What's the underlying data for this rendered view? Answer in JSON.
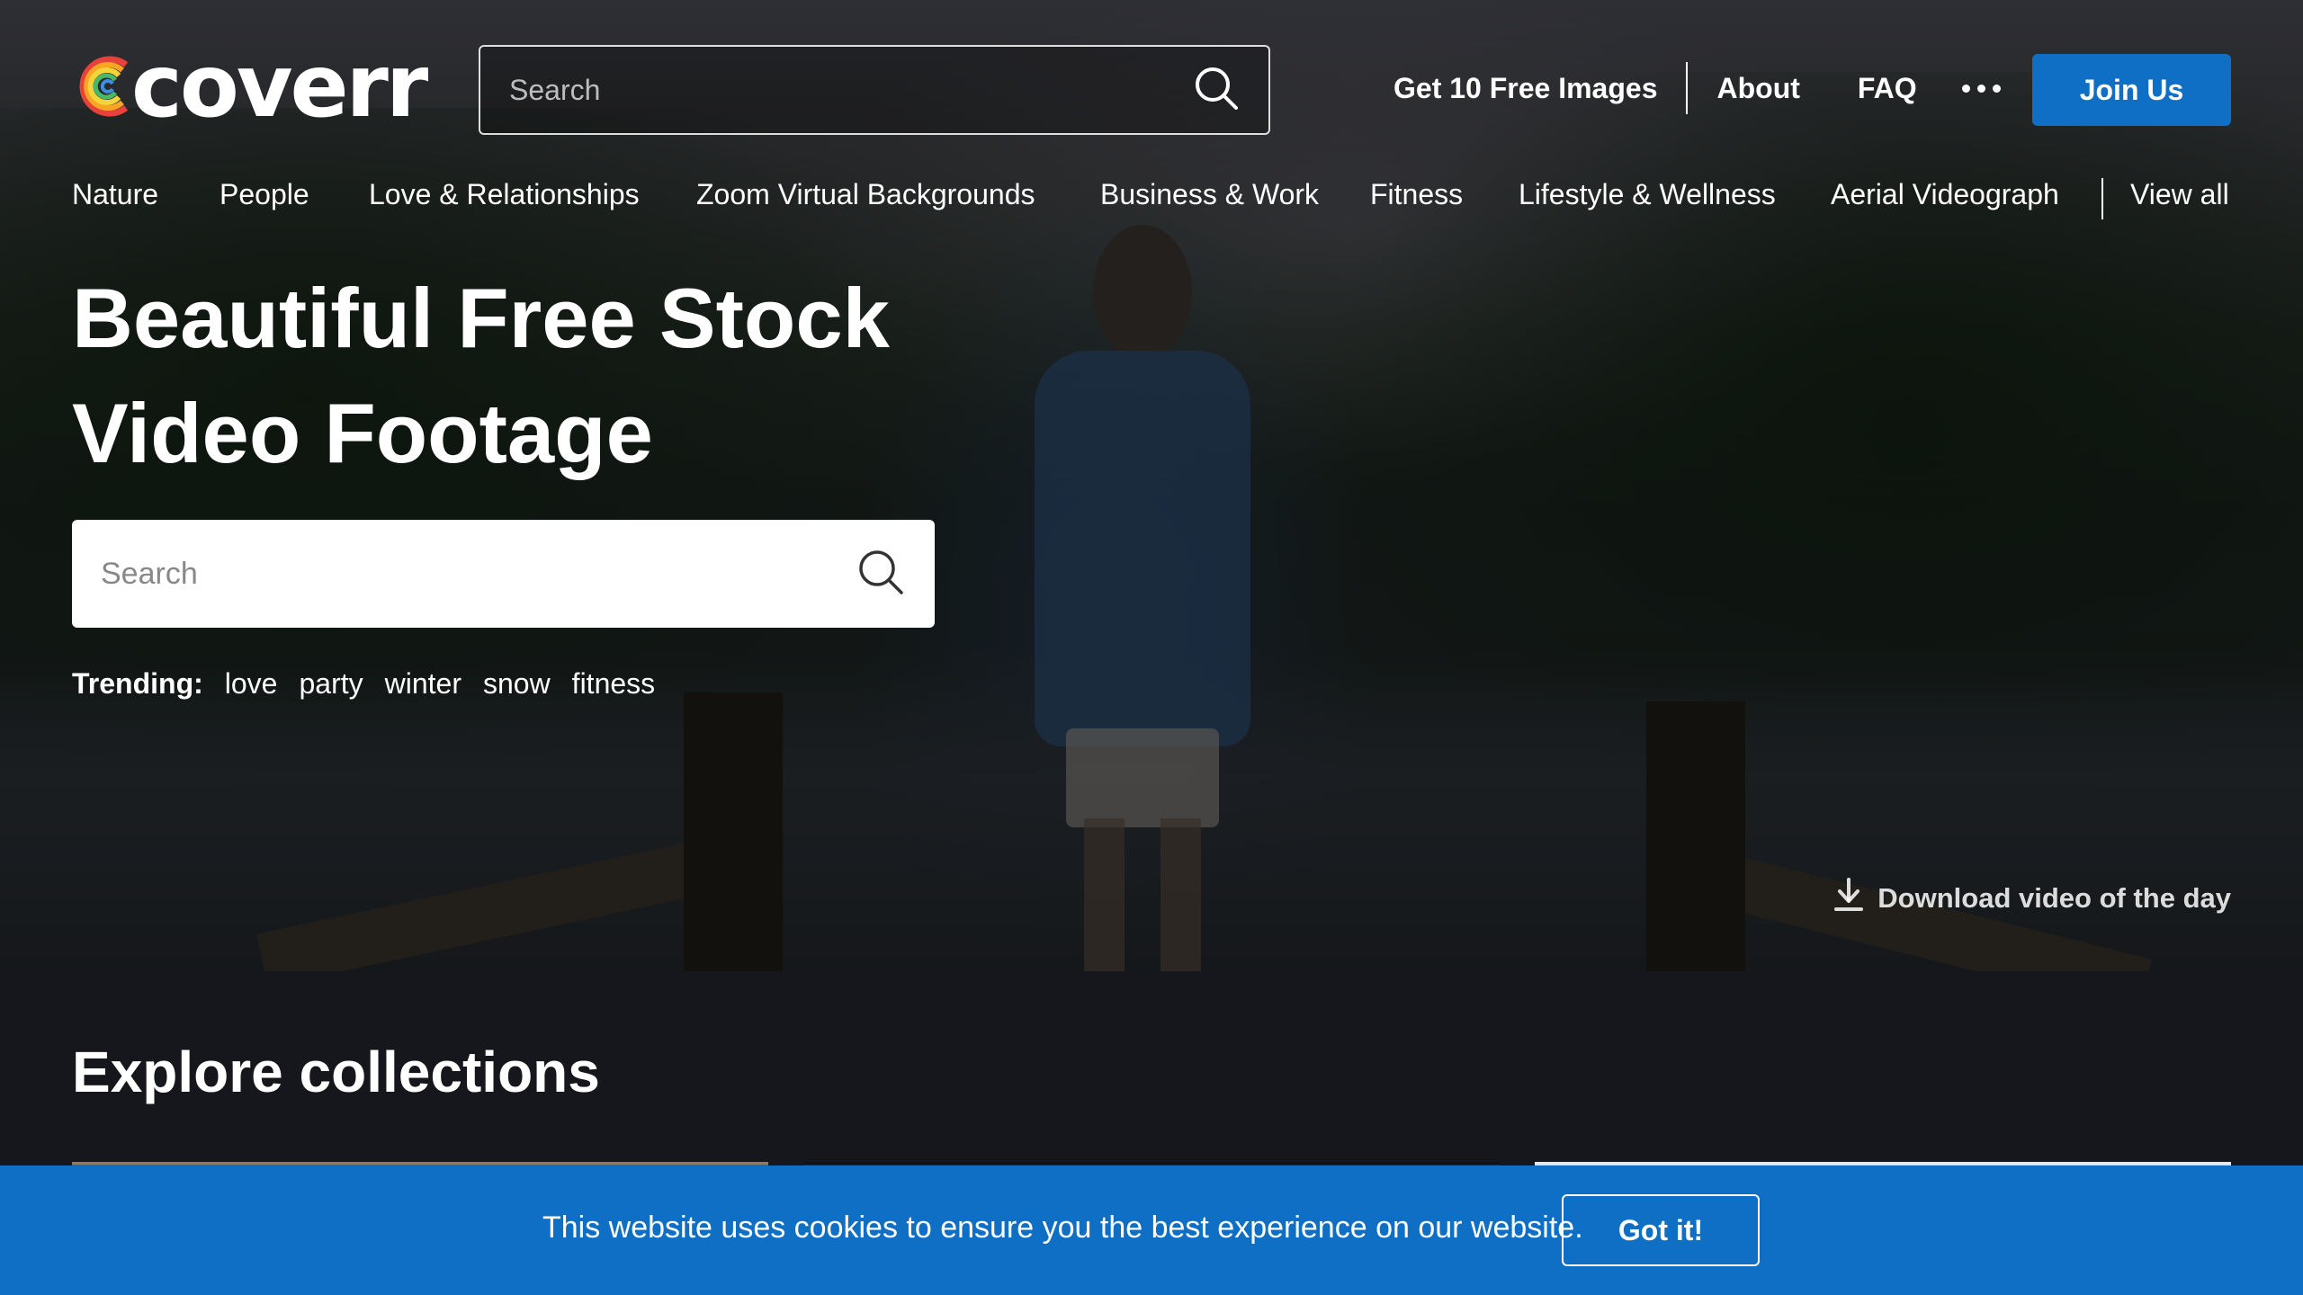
{
  "brand": {
    "name": "coverr"
  },
  "header": {
    "search_placeholder": "Search",
    "nav": {
      "free_images": "Get 10 Free Images",
      "about": "About",
      "faq": "FAQ"
    },
    "join_label": "Join Us"
  },
  "categories": [
    "Nature",
    "People",
    "Love & Relationships",
    "Zoom Virtual Backgrounds",
    "Business & Work",
    "Fitness",
    "Lifestyle & Wellness",
    "Aerial Videograph"
  ],
  "view_all": "View all",
  "hero": {
    "title_line1": "Beautiful Free Stock",
    "title_line2": "Video Footage",
    "search_placeholder": "Search",
    "trending_label": "Trending:",
    "trending": [
      "love",
      "party",
      "winter",
      "snow",
      "fitness"
    ],
    "download_label": "Download video of the day"
  },
  "collections": {
    "title": "Explore collections"
  },
  "cookie": {
    "message": "This website uses cookies to ensure you the best experience on our website.",
    "button": "Got it!"
  },
  "colors": {
    "accent": "#0f6fc5",
    "page_bg": "#16171c",
    "logo_rings": [
      "#e8413c",
      "#f6a623",
      "#f5d33b",
      "#4ab867",
      "#3a8fe0"
    ]
  },
  "icons": {
    "search": "search-icon",
    "more": "more-dots-icon",
    "download": "download-icon",
    "logo": "coverr-logo-icon"
  }
}
